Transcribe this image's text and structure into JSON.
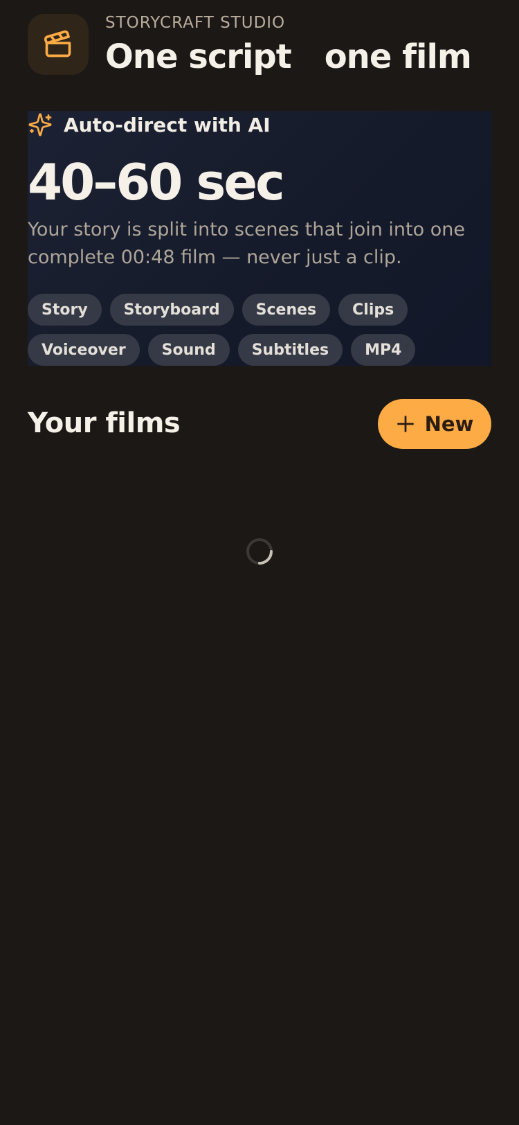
{
  "header": {
    "brand": "STORYCRAFT STUDIO",
    "title_part1": "One script",
    "title_part2": "one film",
    "icon": "clapperboard-icon"
  },
  "hero": {
    "label": "Auto-direct with AI",
    "label_icon": "sparkles-icon",
    "duration": "40–60 sec",
    "description": "Your story is split into scenes that join into  one complete 00:48 film — never just a clip.",
    "chips": [
      "Story",
      "Storyboard",
      "Scenes",
      "Clips",
      "Voiceover",
      "Sound",
      "Subtitles",
      "MP4"
    ]
  },
  "films": {
    "title": "Your films",
    "new_label": "New",
    "new_icon": "plus-icon",
    "loading_icon": "spinner-icon"
  },
  "colors": {
    "background": "#1c1816",
    "accent": "#fcab45",
    "hero_bg": "#171c2c",
    "chip_bg": "#363a46"
  }
}
